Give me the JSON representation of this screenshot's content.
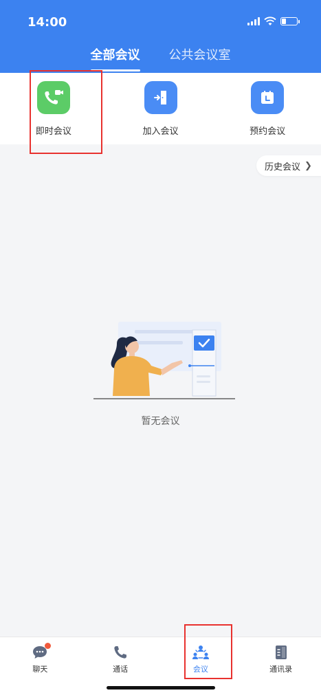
{
  "status": {
    "time": "14:00"
  },
  "tabs": [
    {
      "label": "全部会议",
      "active": true
    },
    {
      "label": "公共会议室",
      "active": false
    }
  ],
  "actions": [
    {
      "label": "即时会议",
      "icon": "video-call-icon",
      "color": "#5ccc67"
    },
    {
      "label": "加入会议",
      "icon": "join-door-icon",
      "color": "#4a8cf5"
    },
    {
      "label": "预约会议",
      "icon": "calendar-icon",
      "color": "#4a8cf5"
    }
  ],
  "history": {
    "label": "历史会议"
  },
  "empty": {
    "text": "暂无会议"
  },
  "nav": [
    {
      "label": "聊天",
      "icon": "chat-icon",
      "badge": true
    },
    {
      "label": "通话",
      "icon": "phone-icon"
    },
    {
      "label": "会议",
      "icon": "meeting-icon",
      "active": true
    },
    {
      "label": "通讯录",
      "icon": "contacts-icon"
    }
  ],
  "colors": {
    "primary": "#3c82f0",
    "green": "#5ccc67",
    "highlight": "#e8312e",
    "badge": "#f05a3c"
  }
}
